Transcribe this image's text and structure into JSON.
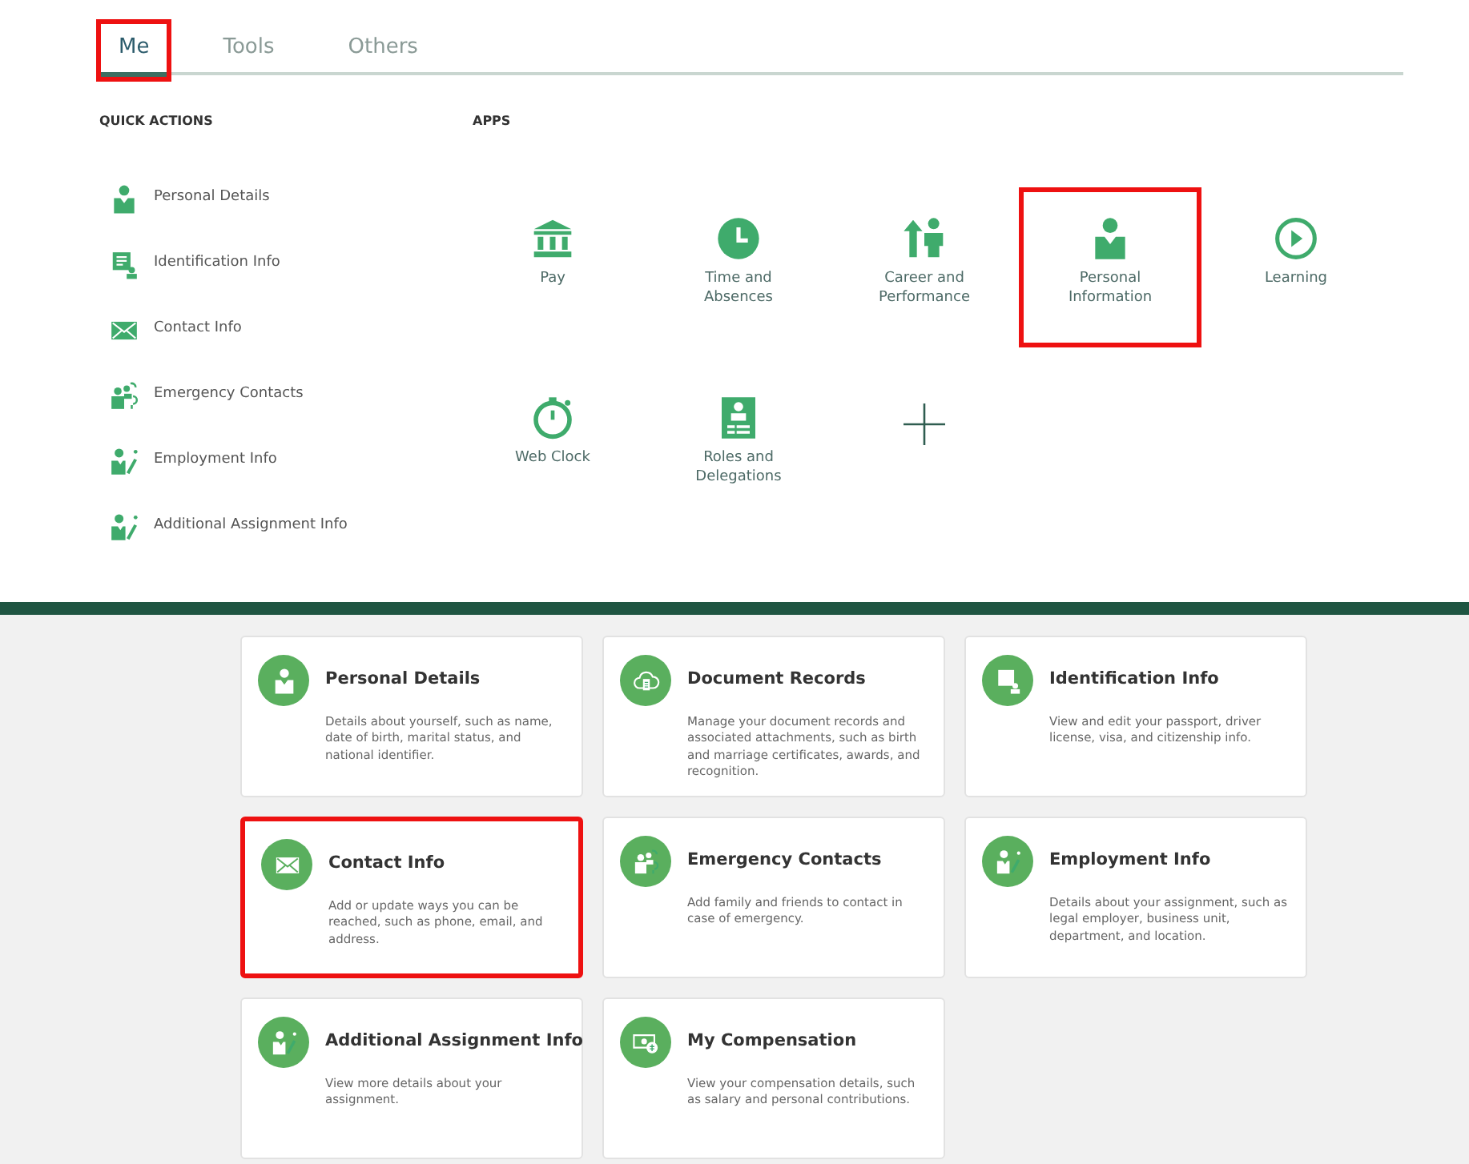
{
  "tabs": [
    {
      "label": "Me",
      "selected": true,
      "highlighted": true
    },
    {
      "label": "Tools",
      "selected": false,
      "highlighted": false
    },
    {
      "label": "Others",
      "selected": false,
      "highlighted": false
    }
  ],
  "quick_actions": {
    "heading": "QUICK ACTIONS",
    "items": [
      {
        "label": "Personal Details"
      },
      {
        "label": "Identification Info"
      },
      {
        "label": "Contact Info"
      },
      {
        "label": "Emergency Contacts"
      },
      {
        "label": "Employment Info"
      },
      {
        "label": "Additional Assignment Info"
      }
    ]
  },
  "apps": {
    "heading": "APPS",
    "items": [
      {
        "kind": "app",
        "label": "Pay",
        "highlighted": false
      },
      {
        "kind": "app",
        "label": "Time and Absences",
        "highlighted": false
      },
      {
        "kind": "app",
        "label": "Career and Performance",
        "highlighted": false
      },
      {
        "kind": "app",
        "label": "Personal Information",
        "highlighted": true
      },
      {
        "kind": "app",
        "label": "Learning",
        "highlighted": false
      },
      {
        "kind": "app",
        "label": "Web Clock",
        "highlighted": false
      },
      {
        "kind": "app",
        "label": "Roles and Delegations",
        "highlighted": false
      },
      {
        "kind": "add",
        "highlighted": false
      }
    ]
  },
  "cards": [
    {
      "title": "Personal Details",
      "description": "Details about yourself, such as name, date of birth, marital status, and national identifier.",
      "highlighted": false
    },
    {
      "title": "Document Records",
      "description": "Manage your document records and associated attachments, such as birth and marriage certificates, awards, and recognition.",
      "highlighted": false
    },
    {
      "title": "Identification Info",
      "description": "View and edit your passport, driver license, visa, and citizenship info.",
      "highlighted": false
    },
    {
      "title": "Contact Info",
      "description": "Add or update ways you can be reached, such as phone, email, and address.",
      "highlighted": true
    },
    {
      "title": "Emergency Contacts",
      "description": "Add family and friends to contact in case of emergency.",
      "highlighted": false
    },
    {
      "title": "Employment Info",
      "description": "Details about your assignment, such as legal employer, business unit, department, and location.",
      "highlighted": false
    },
    {
      "title": "Additional Assignment Info",
      "description": "View more details about your assignment.",
      "highlighted": false
    },
    {
      "title": "My Compensation",
      "description": "View your compensation details, such as salary and personal contributions.",
      "highlighted": false
    }
  ]
}
